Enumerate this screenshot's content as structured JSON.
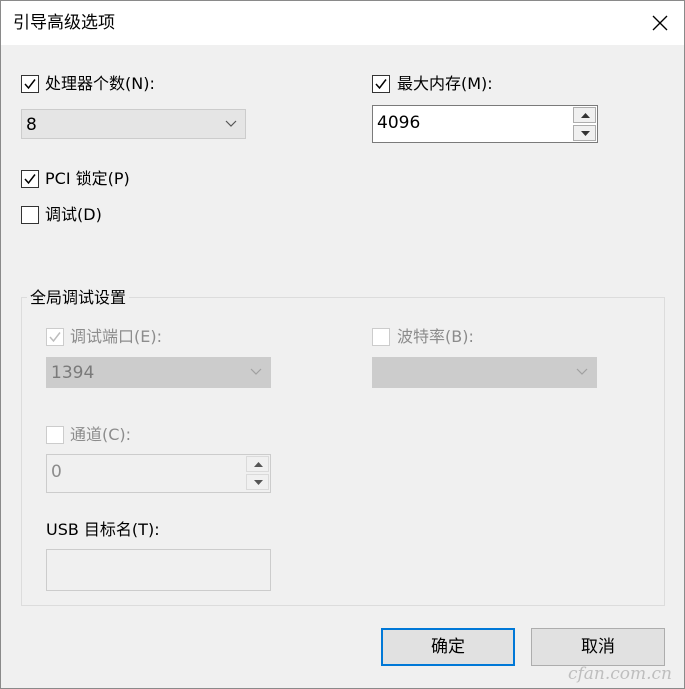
{
  "window": {
    "title": "引导高级选项"
  },
  "processors": {
    "label": "处理器个数(N):",
    "checked": true,
    "value": "8"
  },
  "max_memory": {
    "label": "最大内存(M):",
    "checked": true,
    "value": "4096"
  },
  "pci_lock": {
    "label": "PCI 锁定(P)",
    "checked": true
  },
  "debug": {
    "label": "调试(D)",
    "checked": false
  },
  "global_debug": {
    "title": "全局调试设置",
    "debug_port": {
      "label": "调试端口(E):",
      "checked": true,
      "value": "1394"
    },
    "baud_rate": {
      "label": "波特率(B):",
      "checked": false,
      "value": ""
    },
    "channel": {
      "label": "通道(C):",
      "checked": false,
      "value": "0"
    },
    "usb_target": {
      "label": "USB 目标名(T):",
      "value": ""
    }
  },
  "buttons": {
    "ok": "确定",
    "cancel": "取消"
  },
  "watermark": "cfan.com.cn"
}
